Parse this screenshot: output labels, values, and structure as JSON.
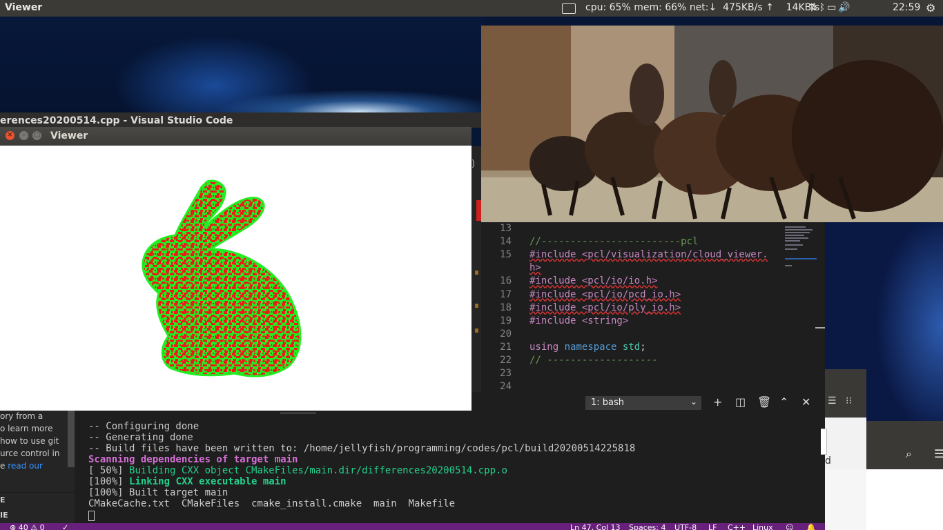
{
  "topbar": {
    "app_name": "Viewer",
    "system_monitor": "cpu: 65% mem: 66% net:↓  475KB/s ↑    14KB/s",
    "tray_icons": [
      "network-updown-icon",
      "bluetooth-icon",
      "battery-icon",
      "volume-icon"
    ],
    "clock": "22:59"
  },
  "vscode": {
    "window_title": "erences20200514.cpp - Visual Studio Code",
    "editor": {
      "line_numbers": [
        "13",
        "14",
        "15",
        "",
        "16",
        "17",
        "18",
        "19",
        "20",
        "21",
        "22",
        "23",
        "24"
      ],
      "lines": [
        {
          "kind": "blank",
          "text": ""
        },
        {
          "kind": "comment",
          "text": "//------------------------pcl"
        },
        {
          "kind": "include",
          "text": "#include <pcl/visualization/cloud_viewer."
        },
        {
          "kind": "include",
          "text": "h>"
        },
        {
          "kind": "include",
          "text": "#include <pcl/io/io.h>"
        },
        {
          "kind": "include",
          "text": "#include <pcl/io/pcd_io.h>"
        },
        {
          "kind": "include",
          "text": "#include <pcl/io/ply_io.h>"
        },
        {
          "kind": "directive",
          "text": "#include <string>"
        },
        {
          "kind": "blank",
          "text": ""
        },
        {
          "kind": "using",
          "using": "using",
          "namespace": "namespace",
          "name": "std",
          "semi": ";"
        },
        {
          "kind": "comment",
          "text": "// -------------------"
        },
        {
          "kind": "blank",
          "text": ""
        },
        {
          "kind": "blank",
          "text": ""
        }
      ]
    },
    "terminal": {
      "selected_shell": "1: bash",
      "lines": [
        {
          "style": "plain",
          "text": "-- Configuring done"
        },
        {
          "style": "plain",
          "text": "-- Generating done"
        },
        {
          "style": "plain",
          "text": "-- Build files have been written to: /home/jellyfish/programming/codes/pcl/build20200514225818"
        },
        {
          "style": "magenta",
          "text": "Scanning dependencies of target main"
        },
        {
          "style": "progress-green",
          "prefix": "[ 50%] ",
          "text": "Building CXX object CMakeFiles/main.dir/differences20200514.cpp.o"
        },
        {
          "style": "progress-greenbold",
          "prefix": "[100%] ",
          "text": "Linking CXX executable main"
        },
        {
          "style": "plain",
          "text": "[100%] Built target main"
        },
        {
          "style": "plain",
          "text": "CMakeCache.txt  CMakeFiles  cmake_install.cmake  main  Makefile"
        }
      ]
    },
    "sidebar_snippet": {
      "lines": [
        "ory from a",
        "o learn more",
        "how to use git",
        "urce control in"
      ],
      "last_line_prefix": "e ",
      "link": "read our",
      "sections": [
        "E",
        "IE"
      ]
    },
    "statusbar": {
      "problems": "⊗ 40 ⚠ 0",
      "position": "Ln 47, Col 13",
      "spaces": "Spaces: 4",
      "encoding": "UTF-8",
      "eol": "LF",
      "language": "C++",
      "os": "Linux"
    }
  },
  "viewer": {
    "title": "Viewer"
  },
  "right_window": {
    "partial_text": "d"
  }
}
